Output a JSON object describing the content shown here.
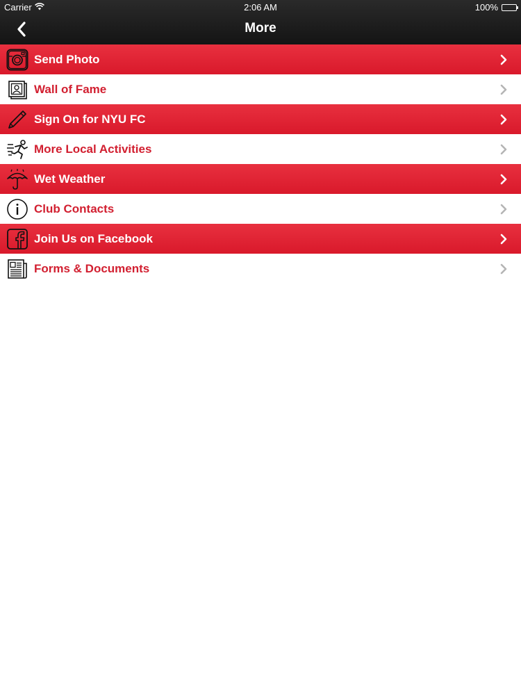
{
  "status_bar": {
    "carrier": "Carrier",
    "time": "2:06 AM",
    "battery": "100%"
  },
  "navbar": {
    "title": "More",
    "back_icon": "chevron-left-icon"
  },
  "colors": {
    "accent_red": "#d9192b",
    "navbar_dark": "#1a1a1a",
    "label_red": "#d21f30"
  },
  "menu": {
    "items": [
      {
        "label": "Send Photo",
        "icon": "camera-icon",
        "style": "red"
      },
      {
        "label": "Wall of Fame",
        "icon": "photo-frame-icon",
        "style": "white"
      },
      {
        "label": "Sign On for NYU FC",
        "icon": "pencil-icon",
        "style": "red"
      },
      {
        "label": "More Local Activities",
        "icon": "running-person-icon",
        "style": "white"
      },
      {
        "label": "Wet Weather",
        "icon": "umbrella-icon",
        "style": "red"
      },
      {
        "label": "Club Contacts",
        "icon": "info-icon",
        "style": "white"
      },
      {
        "label": "Join Us on Facebook",
        "icon": "facebook-icon",
        "style": "red"
      },
      {
        "label": "Forms & Documents",
        "icon": "newspaper-icon",
        "style": "white"
      }
    ]
  }
}
